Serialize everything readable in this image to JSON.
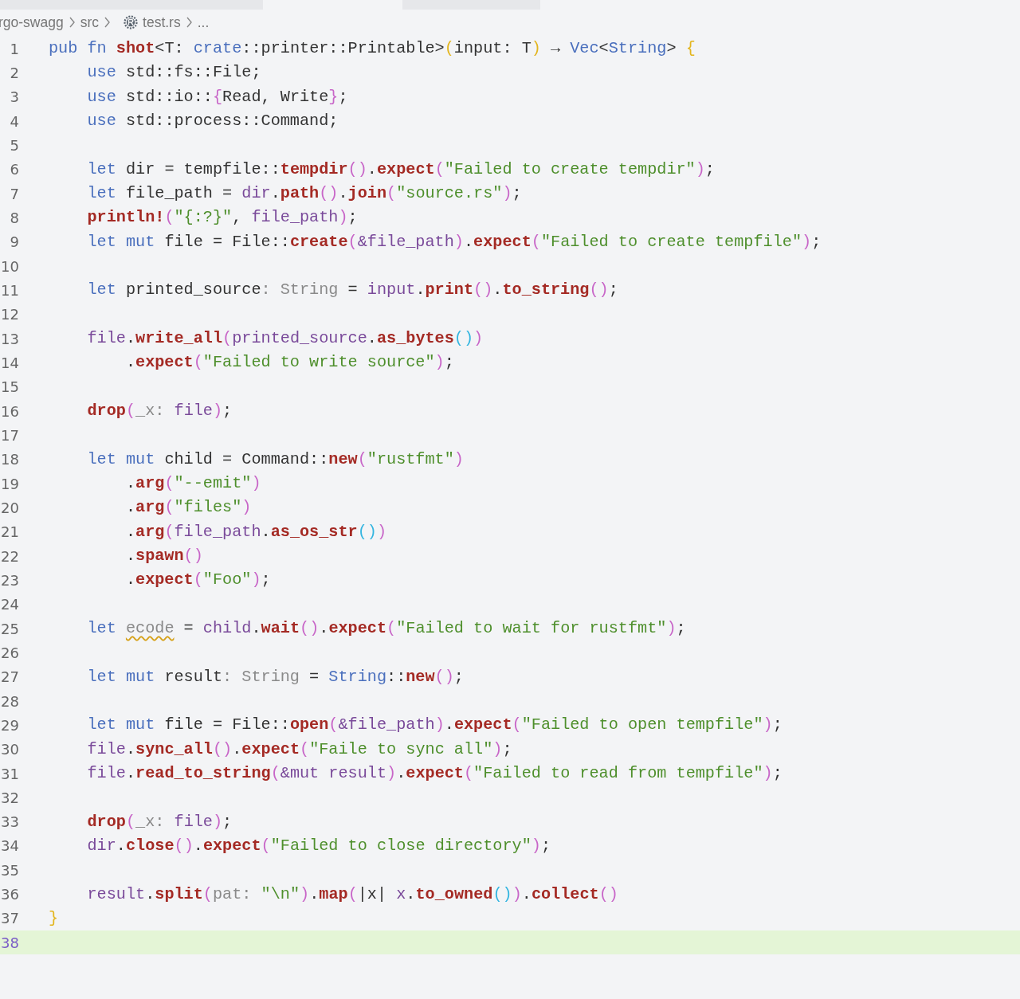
{
  "breadcrumb": [
    {
      "kind": "folder",
      "text": "rgo-swagg"
    },
    {
      "kind": "folder",
      "text": "src"
    },
    {
      "kind": "file",
      "text": "test.rs"
    },
    {
      "kind": "more",
      "text": "..."
    }
  ],
  "lines": [
    {
      "number": "1",
      "current": false,
      "tokens": [
        {
          "kind": "kw",
          "text": "pub fn "
        },
        {
          "kind": "fn",
          "text": "shot"
        },
        {
          "kind": "plain",
          "text": "<T: "
        },
        {
          "kind": "kw",
          "text": "crate"
        },
        {
          "kind": "plain",
          "text": "::printer::Printable>"
        },
        {
          "kind": "b0",
          "text": "("
        },
        {
          "kind": "plain",
          "text": "input: T"
        },
        {
          "kind": "b0",
          "text": ")"
        },
        {
          "kind": "plain",
          "text": " → "
        },
        {
          "kind": "kw",
          "text": "Vec"
        },
        {
          "kind": "plain",
          "text": "<"
        },
        {
          "kind": "kw",
          "text": "String"
        },
        {
          "kind": "plain",
          "text": "> "
        },
        {
          "kind": "b0",
          "text": "{"
        }
      ]
    },
    {
      "number": "2",
      "current": false,
      "tokens": [
        {
          "kind": "kw",
          "text": "    use "
        },
        {
          "kind": "plain",
          "text": "std::fs::File;"
        }
      ]
    },
    {
      "number": "3",
      "current": false,
      "tokens": [
        {
          "kind": "kw",
          "text": "    use "
        },
        {
          "kind": "plain",
          "text": "std::io::"
        },
        {
          "kind": "b1",
          "text": "{"
        },
        {
          "kind": "plain",
          "text": "Read, Write"
        },
        {
          "kind": "b1",
          "text": "}"
        },
        {
          "kind": "plain",
          "text": ";"
        }
      ]
    },
    {
      "number": "4",
      "current": false,
      "tokens": [
        {
          "kind": "kw",
          "text": "    use "
        },
        {
          "kind": "plain",
          "text": "std::process::Command;"
        }
      ]
    },
    {
      "number": "5",
      "current": false
    },
    {
      "number": "6",
      "current": false,
      "tokens": [
        {
          "kind": "kw",
          "text": "    let "
        },
        {
          "kind": "plain",
          "text": "dir = tempfile::"
        },
        {
          "kind": "fn",
          "text": "tempdir"
        },
        {
          "kind": "b1",
          "text": "()"
        },
        {
          "kind": "plain",
          "text": "."
        },
        {
          "kind": "fn",
          "text": "expect"
        },
        {
          "kind": "b1",
          "text": "("
        },
        {
          "kind": "str",
          "text": "\"Failed to create tempdir\""
        },
        {
          "kind": "b1",
          "text": ")"
        },
        {
          "kind": "plain",
          "text": ";"
        }
      ]
    },
    {
      "number": "7",
      "current": false,
      "tokens": [
        {
          "kind": "kw",
          "text": "    let "
        },
        {
          "kind": "plain",
          "text": "file_path = "
        },
        {
          "kind": "var",
          "text": "dir"
        },
        {
          "kind": "plain",
          "text": "."
        },
        {
          "kind": "fn",
          "text": "path"
        },
        {
          "kind": "b1",
          "text": "()"
        },
        {
          "kind": "plain",
          "text": "."
        },
        {
          "kind": "fn",
          "text": "join"
        },
        {
          "kind": "b1",
          "text": "("
        },
        {
          "kind": "str",
          "text": "\"source.rs\""
        },
        {
          "kind": "b1",
          "text": ")"
        },
        {
          "kind": "plain",
          "text": ";"
        }
      ]
    },
    {
      "number": "8",
      "current": false,
      "tokens": [
        {
          "kind": "fn",
          "text": "    println!"
        },
        {
          "kind": "b1",
          "text": "("
        },
        {
          "kind": "str",
          "text": "\"{:?}\""
        },
        {
          "kind": "plain",
          "text": ", "
        },
        {
          "kind": "var",
          "text": "file_path"
        },
        {
          "kind": "b1",
          "text": ")"
        },
        {
          "kind": "plain",
          "text": ";"
        }
      ]
    },
    {
      "number": "9",
      "current": false,
      "tokens": [
        {
          "kind": "kw",
          "text": "    let mut "
        },
        {
          "kind": "plain",
          "text": "file = File::"
        },
        {
          "kind": "fn",
          "text": "create"
        },
        {
          "kind": "b1",
          "text": "("
        },
        {
          "kind": "var",
          "text": "&file_path"
        },
        {
          "kind": "b1",
          "text": ")"
        },
        {
          "kind": "plain",
          "text": "."
        },
        {
          "kind": "fn",
          "text": "expect"
        },
        {
          "kind": "b1",
          "text": "("
        },
        {
          "kind": "str",
          "text": "\"Failed to create tempfile\""
        },
        {
          "kind": "b1",
          "text": ")"
        },
        {
          "kind": "plain",
          "text": ";"
        }
      ]
    },
    {
      "number": "10",
      "current": false
    },
    {
      "number": "11",
      "current": false,
      "tokens": [
        {
          "kind": "kw",
          "text": "    let "
        },
        {
          "kind": "plain",
          "text": "printed_source"
        },
        {
          "kind": "hint",
          "text": ": String"
        },
        {
          "kind": "plain",
          "text": " = "
        },
        {
          "kind": "var",
          "text": "input"
        },
        {
          "kind": "plain",
          "text": "."
        },
        {
          "kind": "fn",
          "text": "print"
        },
        {
          "kind": "b1",
          "text": "()"
        },
        {
          "kind": "plain",
          "text": "."
        },
        {
          "kind": "fn",
          "text": "to_string"
        },
        {
          "kind": "b1",
          "text": "()"
        },
        {
          "kind": "plain",
          "text": ";"
        }
      ]
    },
    {
      "number": "12",
      "current": false
    },
    {
      "number": "13",
      "current": false,
      "tokens": [
        {
          "kind": "var",
          "text": "    file"
        },
        {
          "kind": "plain",
          "text": "."
        },
        {
          "kind": "fn",
          "text": "write_all"
        },
        {
          "kind": "b1",
          "text": "("
        },
        {
          "kind": "var",
          "text": "printed_source"
        },
        {
          "kind": "plain",
          "text": "."
        },
        {
          "kind": "fn",
          "text": "as_bytes"
        },
        {
          "kind": "b2",
          "text": "()"
        },
        {
          "kind": "b1",
          "text": ")"
        }
      ]
    },
    {
      "number": "14",
      "current": false,
      "tokens": [
        {
          "kind": "plain",
          "text": "        ."
        },
        {
          "kind": "fn",
          "text": "expect"
        },
        {
          "kind": "b1",
          "text": "("
        },
        {
          "kind": "str",
          "text": "\"Failed to write source\""
        },
        {
          "kind": "b1",
          "text": ")"
        },
        {
          "kind": "plain",
          "text": ";"
        }
      ]
    },
    {
      "number": "15",
      "current": false
    },
    {
      "number": "16",
      "current": false,
      "tokens": [
        {
          "kind": "fn",
          "text": "    drop"
        },
        {
          "kind": "b1",
          "text": "("
        },
        {
          "kind": "hint",
          "text": "_x: "
        },
        {
          "kind": "var",
          "text": "file"
        },
        {
          "kind": "b1",
          "text": ")"
        },
        {
          "kind": "plain",
          "text": ";"
        }
      ]
    },
    {
      "number": "17",
      "current": false
    },
    {
      "number": "18",
      "current": false,
      "tokens": [
        {
          "kind": "kw",
          "text": "    let mut "
        },
        {
          "kind": "plain",
          "text": "child = Command::"
        },
        {
          "kind": "fn",
          "text": "new"
        },
        {
          "kind": "b1",
          "text": "("
        },
        {
          "kind": "str",
          "text": "\"rustfmt\""
        },
        {
          "kind": "b1",
          "text": ")"
        }
      ]
    },
    {
      "number": "19",
      "current": false,
      "tokens": [
        {
          "kind": "plain",
          "text": "        ."
        },
        {
          "kind": "fn",
          "text": "arg"
        },
        {
          "kind": "b1",
          "text": "("
        },
        {
          "kind": "str",
          "text": "\"--emit\""
        },
        {
          "kind": "b1",
          "text": ")"
        }
      ]
    },
    {
      "number": "20",
      "current": false,
      "tokens": [
        {
          "kind": "plain",
          "text": "        ."
        },
        {
          "kind": "fn",
          "text": "arg"
        },
        {
          "kind": "b1",
          "text": "("
        },
        {
          "kind": "str",
          "text": "\"files\""
        },
        {
          "kind": "b1",
          "text": ")"
        }
      ]
    },
    {
      "number": "21",
      "current": false,
      "tokens": [
        {
          "kind": "plain",
          "text": "        ."
        },
        {
          "kind": "fn",
          "text": "arg"
        },
        {
          "kind": "b1",
          "text": "("
        },
        {
          "kind": "var",
          "text": "file_path"
        },
        {
          "kind": "plain",
          "text": "."
        },
        {
          "kind": "fn",
          "text": "as_os_str"
        },
        {
          "kind": "b2",
          "text": "()"
        },
        {
          "kind": "b1",
          "text": ")"
        }
      ]
    },
    {
      "number": "22",
      "current": false,
      "tokens": [
        {
          "kind": "plain",
          "text": "        ."
        },
        {
          "kind": "fn",
          "text": "spawn"
        },
        {
          "kind": "b1",
          "text": "()"
        }
      ]
    },
    {
      "number": "23",
      "current": false,
      "tokens": [
        {
          "kind": "plain",
          "text": "        ."
        },
        {
          "kind": "fn",
          "text": "expect"
        },
        {
          "kind": "b1",
          "text": "("
        },
        {
          "kind": "str",
          "text": "\"Foo\""
        },
        {
          "kind": "b1",
          "text": ")"
        },
        {
          "kind": "plain",
          "text": ";"
        }
      ]
    },
    {
      "number": "24",
      "current": false
    },
    {
      "number": "25",
      "current": false,
      "tokens": [
        {
          "kind": "kw",
          "text": "    let "
        },
        {
          "kind": "warn",
          "text": "ecode"
        },
        {
          "kind": "plain",
          "text": " = "
        },
        {
          "kind": "var",
          "text": "child"
        },
        {
          "kind": "plain",
          "text": "."
        },
        {
          "kind": "fn",
          "text": "wait"
        },
        {
          "kind": "b1",
          "text": "()"
        },
        {
          "kind": "plain",
          "text": "."
        },
        {
          "kind": "fn",
          "text": "expect"
        },
        {
          "kind": "b1",
          "text": "("
        },
        {
          "kind": "str",
          "text": "\"Failed to wait for rustfmt\""
        },
        {
          "kind": "b1",
          "text": ")"
        },
        {
          "kind": "plain",
          "text": ";"
        }
      ]
    },
    {
      "number": "26",
      "current": false
    },
    {
      "number": "27",
      "current": false,
      "tokens": [
        {
          "kind": "kw",
          "text": "    let mut "
        },
        {
          "kind": "plain",
          "text": "result"
        },
        {
          "kind": "hint",
          "text": ": String"
        },
        {
          "kind": "plain",
          "text": " = "
        },
        {
          "kind": "kw",
          "text": "String"
        },
        {
          "kind": "plain",
          "text": "::"
        },
        {
          "kind": "fn",
          "text": "new"
        },
        {
          "kind": "b1",
          "text": "()"
        },
        {
          "kind": "plain",
          "text": ";"
        }
      ]
    },
    {
      "number": "28",
      "current": false
    },
    {
      "number": "29",
      "current": false,
      "tokens": [
        {
          "kind": "kw",
          "text": "    let mut "
        },
        {
          "kind": "plain",
          "text": "file = File::"
        },
        {
          "kind": "fn",
          "text": "open"
        },
        {
          "kind": "b1",
          "text": "("
        },
        {
          "kind": "var",
          "text": "&file_path"
        },
        {
          "kind": "b1",
          "text": ")"
        },
        {
          "kind": "plain",
          "text": "."
        },
        {
          "kind": "fn",
          "text": "expect"
        },
        {
          "kind": "b1",
          "text": "("
        },
        {
          "kind": "str",
          "text": "\"Failed to open tempfile\""
        },
        {
          "kind": "b1",
          "text": ")"
        },
        {
          "kind": "plain",
          "text": ";"
        }
      ]
    },
    {
      "number": "30",
      "current": false,
      "tokens": [
        {
          "kind": "var",
          "text": "    file"
        },
        {
          "kind": "plain",
          "text": "."
        },
        {
          "kind": "fn",
          "text": "sync_all"
        },
        {
          "kind": "b1",
          "text": "()"
        },
        {
          "kind": "plain",
          "text": "."
        },
        {
          "kind": "fn",
          "text": "expect"
        },
        {
          "kind": "b1",
          "text": "("
        },
        {
          "kind": "str",
          "text": "\"Faile to sync all\""
        },
        {
          "kind": "b1",
          "text": ")"
        },
        {
          "kind": "plain",
          "text": ";"
        }
      ]
    },
    {
      "number": "31",
      "current": false,
      "tokens": [
        {
          "kind": "var",
          "text": "    file"
        },
        {
          "kind": "plain",
          "text": "."
        },
        {
          "kind": "fn",
          "text": "read_to_string"
        },
        {
          "kind": "b1",
          "text": "("
        },
        {
          "kind": "var",
          "text": "&mut result"
        },
        {
          "kind": "b1",
          "text": ")"
        },
        {
          "kind": "plain",
          "text": "."
        },
        {
          "kind": "fn",
          "text": "expect"
        },
        {
          "kind": "b1",
          "text": "("
        },
        {
          "kind": "str",
          "text": "\"Failed to read from tempfile\""
        },
        {
          "kind": "b1",
          "text": ")"
        },
        {
          "kind": "plain",
          "text": ";"
        }
      ]
    },
    {
      "number": "32",
      "current": false
    },
    {
      "number": "33",
      "current": false,
      "tokens": [
        {
          "kind": "fn",
          "text": "    drop"
        },
        {
          "kind": "b1",
          "text": "("
        },
        {
          "kind": "hint",
          "text": "_x: "
        },
        {
          "kind": "var",
          "text": "file"
        },
        {
          "kind": "b1",
          "text": ")"
        },
        {
          "kind": "plain",
          "text": ";"
        }
      ]
    },
    {
      "number": "34",
      "current": false,
      "tokens": [
        {
          "kind": "var",
          "text": "    dir"
        },
        {
          "kind": "plain",
          "text": "."
        },
        {
          "kind": "fn",
          "text": "close"
        },
        {
          "kind": "b1",
          "text": "()"
        },
        {
          "kind": "plain",
          "text": "."
        },
        {
          "kind": "fn",
          "text": "expect"
        },
        {
          "kind": "b1",
          "text": "("
        },
        {
          "kind": "str",
          "text": "\"Failed to close directory\""
        },
        {
          "kind": "b1",
          "text": ")"
        },
        {
          "kind": "plain",
          "text": ";"
        }
      ]
    },
    {
      "number": "35",
      "current": false
    },
    {
      "number": "36",
      "current": false,
      "tokens": [
        {
          "kind": "var",
          "text": "    result"
        },
        {
          "kind": "plain",
          "text": "."
        },
        {
          "kind": "fn",
          "text": "split"
        },
        {
          "kind": "b1",
          "text": "("
        },
        {
          "kind": "hint",
          "text": "pat: "
        },
        {
          "kind": "str",
          "text": "\"\\n\""
        },
        {
          "kind": "b1",
          "text": ")"
        },
        {
          "kind": "plain",
          "text": "."
        },
        {
          "kind": "fn",
          "text": "map"
        },
        {
          "kind": "b1",
          "text": "("
        },
        {
          "kind": "plain",
          "text": "|x| "
        },
        {
          "kind": "var",
          "text": "x"
        },
        {
          "kind": "plain",
          "text": "."
        },
        {
          "kind": "fn",
          "text": "to_owned"
        },
        {
          "kind": "b2",
          "text": "()"
        },
        {
          "kind": "b1",
          "text": ")"
        },
        {
          "kind": "plain",
          "text": "."
        },
        {
          "kind": "fn",
          "text": "collect"
        },
        {
          "kind": "b1",
          "text": "()"
        }
      ]
    },
    {
      "number": "37",
      "current": false,
      "tokens": [
        {
          "kind": "b0",
          "text": "}"
        }
      ]
    },
    {
      "number": "38",
      "current": true
    }
  ]
}
